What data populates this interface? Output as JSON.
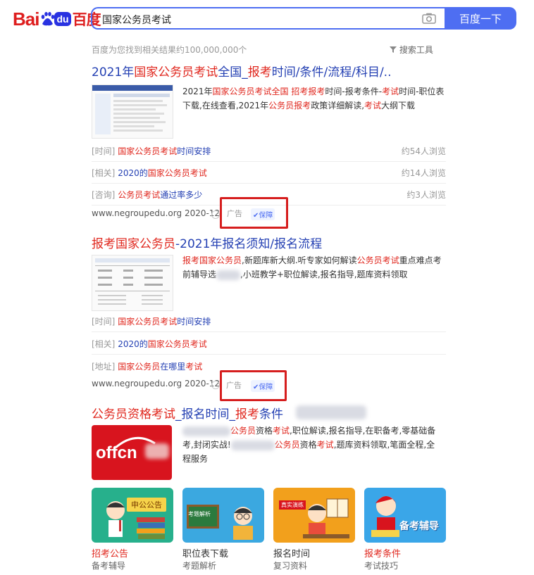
{
  "header": {
    "logo_bai": "Bai",
    "logo_du": "du",
    "logo_cn": "百度",
    "search_value": "国家公务员考试",
    "search_button": "百度一下"
  },
  "result_stats": "百度为您找到相关结果约100,000,000个",
  "search_tools": "搜索工具",
  "result1": {
    "title": [
      "2021年",
      "国家公务员考试",
      "全国_",
      "报考",
      "时间/条件/流程/科目/.."
    ],
    "desc_line1": [
      "2021年",
      "国家公务员考试全国",
      " ",
      "招考报考",
      "时间-报考条件-",
      "考试",
      "时间-职位表"
    ],
    "desc_line2": [
      "下载,在线查看,2021年",
      "公务员报考",
      "政策详细解读,",
      "考试",
      "大纲下载"
    ],
    "subs": [
      {
        "tag": "[时间]",
        "text_red": "国家公务员考试",
        "text": "时间安排",
        "views": "约54人浏览"
      },
      {
        "tag": "[相关]",
        "text_pre": "2020的",
        "text_red": "国家公务员考试",
        "text": "",
        "views": "约14人浏览"
      },
      {
        "tag": "[咨询]",
        "text_red": "公务员考试",
        "text": "通过率多少",
        "views": "约3人浏览"
      }
    ],
    "url": "www.negroupedu.org",
    "date": "2020-12",
    "ad": "广告",
    "safe": "保障"
  },
  "result2": {
    "title": [
      "报考国家公务员",
      "-2021年报名须知/报名流程"
    ],
    "desc_line1": [
      "报考国家公务员",
      ",新题库新大纲.听专家如何解读",
      "公务员考试",
      "重点难点考"
    ],
    "desc_line2": [
      "前辅导选",
      ",小班教学+职位解读,报名指导,题库资料领取"
    ],
    "subs": [
      {
        "tag": "[时间]",
        "text_red": "国家公务员考试",
        "text": "时间安排"
      },
      {
        "tag": "[相关]",
        "text_pre": "2020的",
        "text_red": "国家公务员考试",
        "text": ""
      },
      {
        "tag": "[地址]",
        "text_red": "国家公务员",
        "text": "在哪里",
        "text_red2": "考试"
      }
    ],
    "url": "www.negroupedu.org",
    "date": "2020-12",
    "ad": "广告",
    "safe": "保障"
  },
  "result3": {
    "title": [
      "公务员资格",
      "考试",
      "_报名时间_",
      "报考",
      "条件"
    ],
    "logo_text": "offcn",
    "desc_line1": [
      "公务员",
      "资格",
      "考试",
      ",职位解读,报名指导,在职备考,零基础备"
    ],
    "desc_line2": [
      "考,封闭实战!",
      "公务员",
      "资格",
      "考试",
      ",题库资料领取,笔面全程,全"
    ],
    "desc_line3": "程服务",
    "cards": [
      {
        "title": "招考公告",
        "sub": "备考辅导",
        "img_text": "申公公告",
        "color": "#27b08c"
      },
      {
        "title": "职位表下载",
        "sub": "考题解析",
        "img_text": "考题解析",
        "color": "#3ba8e0"
      },
      {
        "title": "报名时间",
        "sub": "复习资料",
        "img_text": "真实演练",
        "color": "#f2a01c"
      },
      {
        "title": "报考条件",
        "sub": "考试技巧",
        "img_text": "备考辅导",
        "color": "#3aa6e8"
      }
    ]
  },
  "colors": {
    "accent": "#4e6ef2",
    "highlight": "#e0271e",
    "link": "#2440b3"
  }
}
